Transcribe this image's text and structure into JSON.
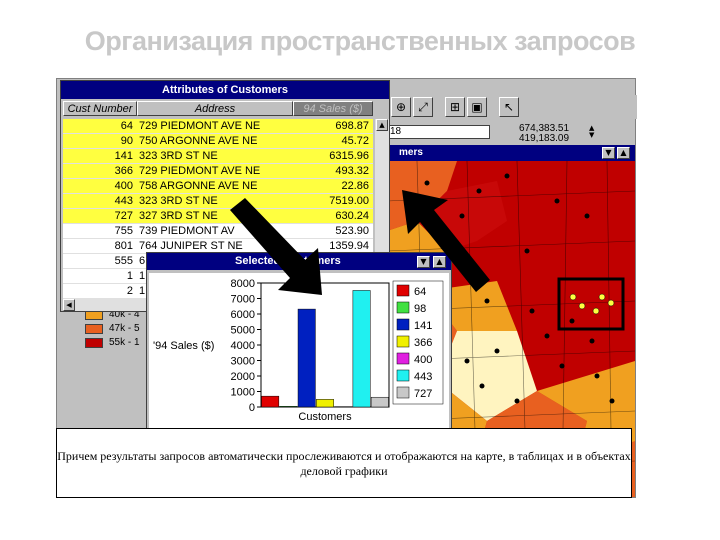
{
  "slide": {
    "title": "Организация пространственных запросов",
    "caption": "Причем результаты запросов автоматически прослеживаются и отображаются на карте, в таблицах и в объектах деловой графики"
  },
  "app": {
    "scale_value": "18",
    "coord_x": "674,383.51",
    "coord_y": "419,183.09",
    "map_title": "mers",
    "legend": [
      {
        "label": "40k - 4",
        "color": "#f0a020"
      },
      {
        "label": "47k - 5",
        "color": "#e86020"
      },
      {
        "label": "55k - 1",
        "color": "#c00000"
      }
    ]
  },
  "attributes": {
    "title": "Attributes of Customers",
    "columns": [
      "Cust Number",
      "Address",
      "94 Sales ($)"
    ],
    "rows": [
      {
        "num": "64",
        "addr": "729 PIEDMONT AVE NE",
        "sales": "698.87",
        "selected": true
      },
      {
        "num": "90",
        "addr": "750 ARGONNE AVE NE",
        "sales": "45.72",
        "selected": true
      },
      {
        "num": "141",
        "addr": "323 3RD ST NE",
        "sales": "6315.96",
        "selected": true
      },
      {
        "num": "366",
        "addr": "729 PIEDMONT AVE NE",
        "sales": "493.32",
        "selected": true
      },
      {
        "num": "400",
        "addr": "758 ARGONNE AVE NE",
        "sales": "22.86",
        "selected": true
      },
      {
        "num": "443",
        "addr": "323 3RD ST NE",
        "sales": "7519.00",
        "selected": true
      },
      {
        "num": "727",
        "addr": "327 3RD ST NE",
        "sales": "630.24",
        "selected": true
      },
      {
        "num": "755",
        "addr": "739 PIEDMONT AV",
        "sales": "523.90",
        "selected": false
      },
      {
        "num": "801",
        "addr": "764 JUNIPER ST NE",
        "sales": "1359.94",
        "selected": false
      },
      {
        "num": "555",
        "addr": "6",
        "sales": "",
        "selected": false
      },
      {
        "num": "1",
        "addr": "1",
        "sales": "",
        "selected": false
      },
      {
        "num": "2",
        "addr": "1",
        "sales": "",
        "selected": false
      }
    ]
  },
  "chart_window": {
    "title": "Selected Customers"
  },
  "chart_data": {
    "type": "bar",
    "title": "",
    "xlabel": "Customers",
    "ylabel": "'94 Sales ($)",
    "ylim": [
      0,
      8000
    ],
    "yticks": [
      "0",
      "1000",
      "2000",
      "3000",
      "4000",
      "5000",
      "6000",
      "7000",
      "8000"
    ],
    "series": [
      {
        "name": "64",
        "values": [
          698.87
        ],
        "color": "#e00000"
      },
      {
        "name": "98",
        "values": [
          45.72
        ],
        "color": "#40e040"
      },
      {
        "name": "141",
        "values": [
          6315.96
        ],
        "color": "#0020c0"
      },
      {
        "name": "366",
        "values": [
          493.32
        ],
        "color": "#f0f000"
      },
      {
        "name": "400",
        "values": [
          22.86
        ],
        "color": "#e020e0"
      },
      {
        "name": "443",
        "values": [
          7519.0
        ],
        "color": "#20f0f0"
      },
      {
        "name": "727",
        "values": [
          630.24
        ],
        "color": "#c8c8c8"
      }
    ],
    "legend_position": "right"
  }
}
